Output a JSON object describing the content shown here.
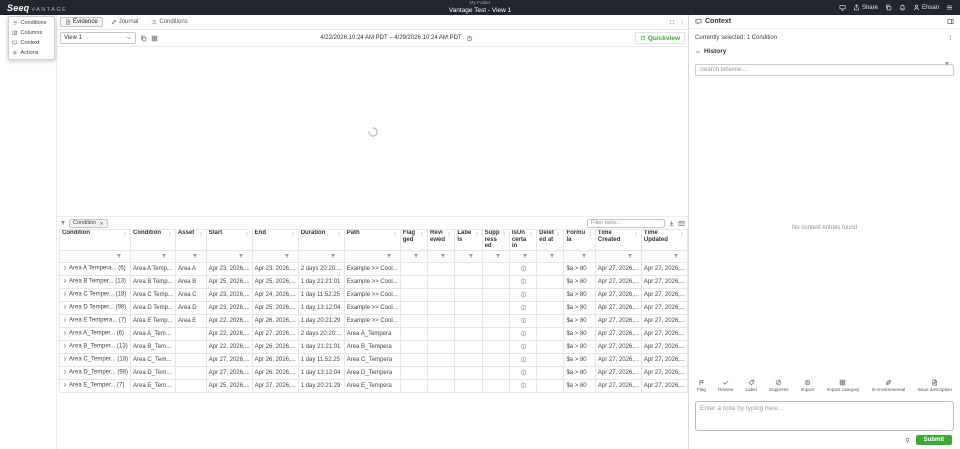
{
  "colors": {
    "accent": "#3aaa35",
    "navbar_bg": "#21252d"
  },
  "navbar": {
    "logo_text": "Seeq",
    "logo_suffix": "VANTAGE",
    "breadcrumb": "My Folder",
    "title": "Vantage Test - View 1",
    "share_label": "Share",
    "user_name": "Ehsan"
  },
  "panel_menu": {
    "items": [
      {
        "label": "Conditions",
        "icon": "list"
      },
      {
        "label": "Columns",
        "icon": "columns"
      },
      {
        "label": "Context",
        "icon": "context"
      },
      {
        "label": "Actions",
        "icon": "gear"
      }
    ]
  },
  "tabs": [
    {
      "label": "Evidence",
      "icon": "doc",
      "active": true
    },
    {
      "label": "Journal",
      "icon": "pencil",
      "active": false
    },
    {
      "label": "Conditions",
      "icon": "list",
      "active": false
    }
  ],
  "toolbar": {
    "view_label": "View 1",
    "date_range": "4/22/2026 10:24 AM PDT – 4/29/2026 10:24 AM PDT",
    "quick_label": "Quickview"
  },
  "table": {
    "chip_label": "Condition",
    "filter_placeholder": "Filter table...",
    "columns": [
      "Condition",
      "Condition",
      "Asset",
      "Start",
      "End",
      "Duration",
      "Path",
      "Flagged",
      "Reviewed",
      "Labels",
      "Suppressed",
      "IsUncertain",
      "Deleted at",
      "Formula",
      "Time Created",
      "Time Updated"
    ],
    "rows": [
      {
        "condition": "Area A Tempera... (6)",
        "name": "Area A Temp...",
        "asset": "Area A",
        "start": "Apr 23, 2026,...",
        "end": "Apr 23, 2026,...",
        "duration": "2 days 20:20:...",
        "path": "Example >> Cool...",
        "formula": "$a > 80",
        "time_created": "Apr 27, 2026,...",
        "time_updated": "Apr 27, 2026,..."
      },
      {
        "condition": "Area B Temper... (13)",
        "name": "Area B Temp...",
        "asset": "Area B",
        "start": "Apr 25, 2026,...",
        "end": "Apr 25, 2026,...",
        "duration": "1 day 21:21:01",
        "path": "Example >> Cool...",
        "formula": "$a > 80",
        "time_created": "Apr 27, 2026,...",
        "time_updated": "Apr 27, 2026,..."
      },
      {
        "condition": "Area C Temper... (18)",
        "name": "Area C Temp...",
        "asset": "Area C",
        "start": "Apr 23, 2026,...",
        "end": "Apr 24, 2026,...",
        "duration": "1 day 11:52:25",
        "path": "Example >> Cool...",
        "formula": "$a > 80",
        "time_created": "Apr 27, 2026,...",
        "time_updated": "Apr 27, 2026,..."
      },
      {
        "condition": "Area D Temper... (98)",
        "name": "Area D Temp...",
        "asset": "Area D",
        "start": "Apr 23, 2026,...",
        "end": "Apr 25, 2026,...",
        "duration": "1 day 13:12:04",
        "path": "Example >> Cool...",
        "formula": "$a > 80",
        "time_created": "Apr 27, 2026,...",
        "time_updated": "Apr 27, 2026,..."
      },
      {
        "condition": "Area E Tempera... (7)",
        "name": "Area E Temp...",
        "asset": "Area E",
        "start": "Apr 22, 2026,...",
        "end": "Apr 26, 2026,...",
        "duration": "1 day 20:21:29",
        "path": "Example >> Cool...",
        "formula": "$a > 80",
        "time_created": "Apr 27, 2026,...",
        "time_updated": "Apr 27, 2026,..."
      },
      {
        "condition": "Area A_Temper... (6)",
        "name": "Area A_Tem...",
        "asset": "",
        "start": "Apr 22, 2026,...",
        "end": "Apr 27, 2026,...",
        "duration": "2 days 20:20:...",
        "path": "Area A_Tempera",
        "formula": "$a > 80",
        "time_created": "Apr 27, 2026,...",
        "time_updated": "Apr 27, 2026,..."
      },
      {
        "condition": "Area B_Temper... (13)",
        "name": "Area B_Tem...",
        "asset": "",
        "start": "Apr 22, 2026,...",
        "end": "Apr 26, 2026,...",
        "duration": "1 day 21:21:01",
        "path": "Area B_Tempera",
        "formula": "$a > 80",
        "time_created": "Apr 27, 2026,...",
        "time_updated": "Apr 27, 2026,..."
      },
      {
        "condition": "Area C_Temper... (18)",
        "name": "Area C_Tem...",
        "asset": "",
        "start": "Apr 27, 2026,...",
        "end": "Apr 26, 2026,...",
        "duration": "1 day 11:52:25",
        "path": "Area C_Tempera",
        "formula": "$a > 80",
        "time_created": "Apr 27, 2026,...",
        "time_updated": "Apr 27, 2026,..."
      },
      {
        "condition": "Area D_Temper... (98)",
        "name": "Area D_Tem...",
        "asset": "",
        "start": "Apr 27, 2026,...",
        "end": "Apr 26, 2026,...",
        "duration": "1 day 13:12:04",
        "path": "Area D_Tempera",
        "formula": "$a > 80",
        "time_created": "Apr 27, 2026,...",
        "time_updated": "Apr 27, 2026,..."
      },
      {
        "condition": "Area E_Temper... (7)",
        "name": "Area E_Tem...",
        "asset": "",
        "start": "Apr 25, 2026,...",
        "end": "Apr 27, 2026,...",
        "duration": "1 day 20:21:29",
        "path": "Area E_Tempera",
        "formula": "$a > 80",
        "time_created": "Apr 27, 2026,...",
        "time_updated": "Apr 27, 2026,..."
      }
    ]
  },
  "context_panel": {
    "title": "Context",
    "selected_text": "Currently selected: 1 Condition",
    "history_label": "History",
    "search_placeholder": "Search timeline...",
    "empty_text": "No context entries found",
    "actions": [
      {
        "label": "Flag",
        "icon": "flag"
      },
      {
        "label": "Review",
        "icon": "check"
      },
      {
        "label": "Label",
        "icon": "tag"
      },
      {
        "label": "Suppress",
        "icon": "suppress"
      },
      {
        "label": "Impact",
        "icon": "impact"
      },
      {
        "label": "Impact category",
        "icon": "grid"
      },
      {
        "label": "Is environmental",
        "icon": "leaf"
      },
      {
        "label": "Issue description",
        "icon": "doc"
      }
    ],
    "note_placeholder": "Enter a note by typing here...",
    "submit_label": "Submit"
  }
}
